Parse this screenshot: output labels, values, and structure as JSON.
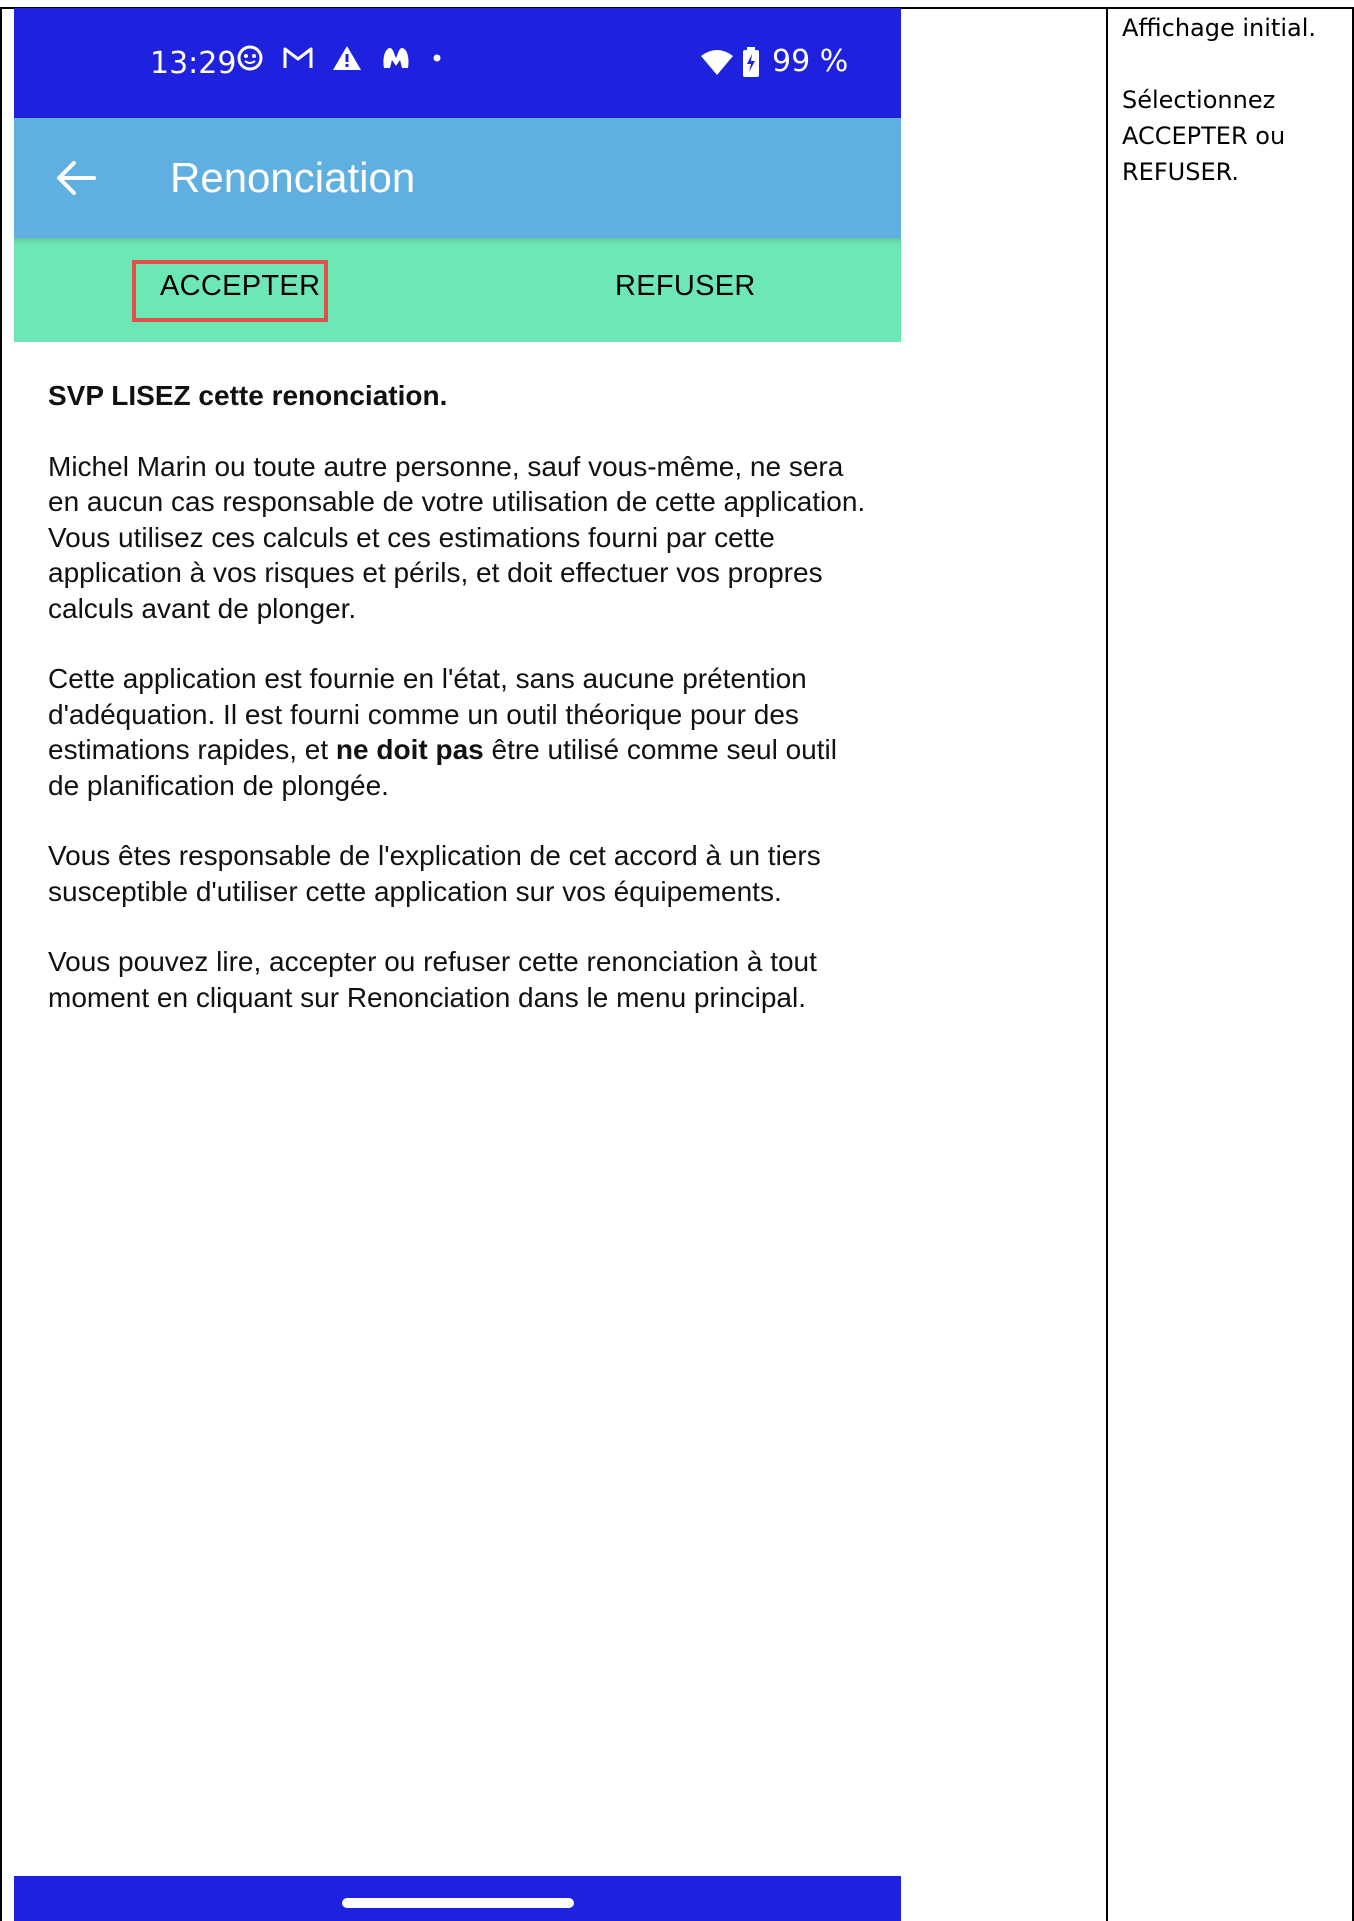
{
  "side_note": {
    "line1": "Affichage initial.",
    "line2": "Sélectionnez ACCEPTER ou REFUSER."
  },
  "status_bar": {
    "time": "13:29",
    "battery": "99 %",
    "icons_left": [
      "smiley-icon",
      "gmail-icon",
      "warning-icon",
      "malwarebytes-icon",
      "dot-icon"
    ],
    "icons_right": [
      "wifi-icon",
      "battery-charging-icon"
    ]
  },
  "app_bar": {
    "title": "Renonciation"
  },
  "tabs": {
    "accept": "ACCEPTER",
    "refuse": "REFUSER"
  },
  "content": {
    "heading": "SVP LISEZ cette renonciation.",
    "para1": "Michel Marin ou toute autre personne, sauf vous-même, ne sera en aucun cas responsable de votre utilisation de cette application. Vous utilisez ces calculs et ces estimations fourni par cette application à vos risques et périls, et doit effectuer vos propres calculs avant de plonger.",
    "para2_a": "Cette application est fournie en l'état, sans aucune prétention d'adéquation. Il est fourni comme un outil théorique pour des estimations rapides, et ",
    "para2_bold": "ne doit pas",
    "para2_b": " être utilisé comme seul outil de planification de plongée.",
    "para3": "Vous êtes responsable de l'explication de cet accord à un tiers susceptible d'utiliser cette application sur vos équipements.",
    "para4": "Vous pouvez lire, accepter ou refuser cette renonciation à tout moment en cliquant sur Renonciation dans le menu principal."
  },
  "colors": {
    "status_bar": "#1e22de",
    "app_bar": "#5fb0e0",
    "tab_bar": "#6ee7b7",
    "highlight": "#e0504a"
  }
}
